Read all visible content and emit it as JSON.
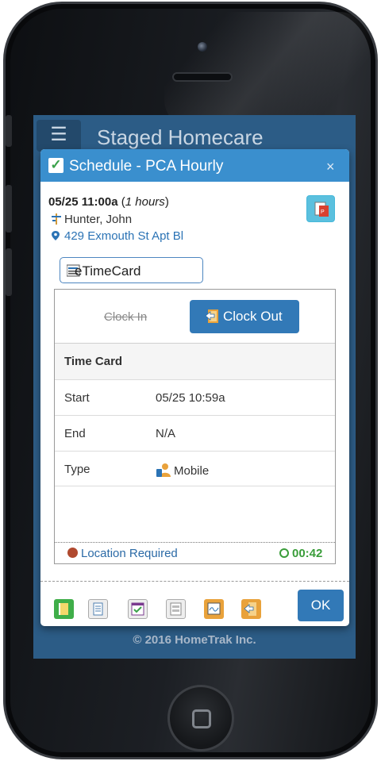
{
  "app": {
    "title": "Staged Homecare",
    "footer": "© 2016 HomeTrak Inc."
  },
  "modal": {
    "title": "Schedule - PCA Hourly",
    "close_label": "×",
    "appt_time": "05/25 11:00a",
    "appt_duration": "1 hours",
    "client_name": "Hunter, John",
    "address": "429 Exmouth St Apt Bl",
    "etimecard_label": "eTimeCard",
    "clock_in_label": "Clock In",
    "clock_out_label": "Clock Out",
    "timecard": {
      "header": "Time Card",
      "rows": [
        {
          "label": "Start",
          "value": "05/25 10:59a"
        },
        {
          "label": "End",
          "value": "N/A"
        },
        {
          "label": "Type",
          "value": "Mobile"
        }
      ]
    },
    "location_required": "Location Required",
    "timer": "00:42",
    "ok_label": "OK"
  },
  "toolbar_icons": [
    "exit-icon",
    "notes-icon",
    "checklist-icon",
    "form-icon",
    "signature-icon",
    "return-icon"
  ],
  "colors": {
    "header_blue": "#3a8fce",
    "button_blue": "#3279b7",
    "app_bar": "#2c5c86",
    "timer_green": "#3a9d3a"
  }
}
